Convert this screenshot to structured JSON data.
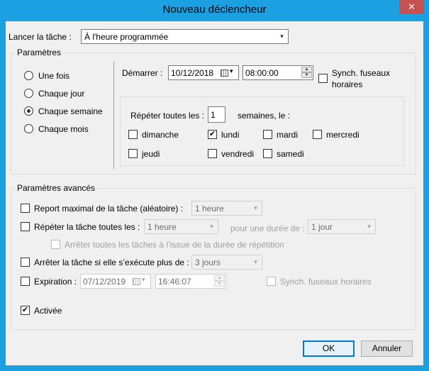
{
  "window": {
    "title": "Nouveau déclencheur",
    "close_glyph": "✕"
  },
  "launch": {
    "label": "Lancer la tâche :",
    "value": "À l'heure programmée"
  },
  "parametres": {
    "title": "Paramètres",
    "schedule_options": [
      {
        "label": "Une fois",
        "selected": false
      },
      {
        "label": "Chaque jour",
        "selected": false
      },
      {
        "label": "Chaque semaine",
        "selected": true
      },
      {
        "label": "Chaque mois",
        "selected": false
      }
    ],
    "start_label": "Démarrer :",
    "start_date": "10/12/2018",
    "start_time": "08:00:00",
    "sync_timezones_label": "Synch. fuseaux horaires",
    "sync_timezones_checked": false,
    "repeat_label": "Répéter toutes les :",
    "repeat_value": "1",
    "repeat_unit": "semaines, le :",
    "days": [
      {
        "label": "dimanche",
        "checked": false
      },
      {
        "label": "lundi",
        "checked": true
      },
      {
        "label": "mardi",
        "checked": false
      },
      {
        "label": "mercredi",
        "checked": false
      },
      {
        "label": "jeudi",
        "checked": false
      },
      {
        "label": "vendredi",
        "checked": false
      },
      {
        "label": "samedi",
        "checked": false
      }
    ]
  },
  "avances": {
    "title": "Paramètres avancés",
    "max_delay_label": "Report maximal de la tâche (aléatoire) :",
    "max_delay_value": "1 heure",
    "repeat_task_label": "Répéter la tâche toutes les :",
    "repeat_task_value": "1 heure",
    "duration_label": "pour une durée de :",
    "duration_value": "1 jour",
    "stop_all_label": "Arrêter toutes les tâches à l’issue de la durée de répétition",
    "stop_if_label": "Arrêter la tâche si elle s’exécute plus de :",
    "stop_if_value": "3 jours",
    "expiration_label": "Expiration :",
    "expiration_date": "07/12/2019",
    "expiration_time": "16:46:07",
    "expiration_sync_label": "Synch. fuseaux horaires",
    "enabled_label": "Activée",
    "enabled_checked": true
  },
  "buttons": {
    "ok": "OK",
    "cancel": "Annuler"
  },
  "glyphs": {
    "check": "✔",
    "combo_arrow": "▾",
    "spin_up": "▲",
    "spin_down": "▼"
  },
  "colors": {
    "title_bar": "#1ba1e2",
    "close_button": "#c75050",
    "default_button_border": "#0078d7"
  }
}
